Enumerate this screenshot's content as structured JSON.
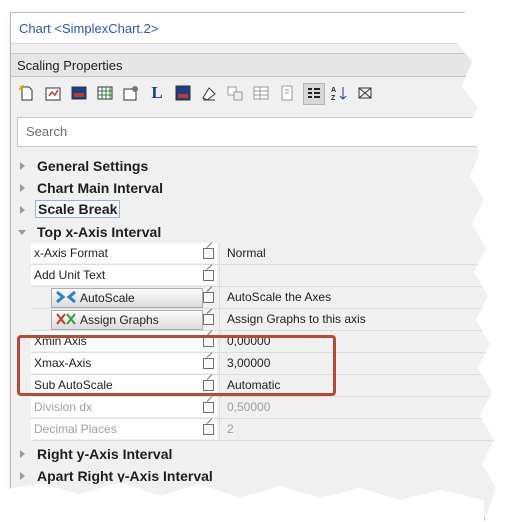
{
  "window": {
    "title": "Chart <SimplexChart.2>"
  },
  "section": {
    "label": "Scaling Properties"
  },
  "toolbar": {
    "icons": [
      "new-icon",
      "properties-icon",
      "chart-icon",
      "grid-icon",
      "settings-icon",
      "axis-L-icon",
      "color-icon",
      "paint-icon",
      "graph-icon",
      "table-icon",
      "help-icon",
      "categorize-icon",
      "sort-icon",
      "expand-icon"
    ]
  },
  "search": {
    "placeholder": "Search"
  },
  "groups": {
    "general": "General Settings",
    "main_interval": "Chart Main Interval",
    "scale_break": "Scale Break",
    "top_x": "Top x-Axis Interval",
    "right_y": "Right y-Axis Interval",
    "apart_right_y": "Apart Right y-Axis Interval"
  },
  "properties": [
    {
      "name": "x-Axis Format",
      "value": "Normal"
    },
    {
      "name": "Add Unit Text",
      "value": ""
    },
    {
      "name": "AutoScale",
      "value": "AutoScale the Axes"
    },
    {
      "name": "Assign Graphs",
      "value": "Assign Graphs to this axis"
    },
    {
      "name": "Xmin Axis",
      "value": "0,00000"
    },
    {
      "name": "Xmax-Axis",
      "value": "3,00000"
    },
    {
      "name": "Sub AutoScale",
      "value": "Automatic"
    },
    {
      "name": "Division dx",
      "value": "0,50000"
    },
    {
      "name": "Decimal Places",
      "value": "2"
    }
  ],
  "colors": {
    "highlight": "#b14b3a",
    "title": "#2b58a6",
    "disabled": "#a0a0a0"
  }
}
